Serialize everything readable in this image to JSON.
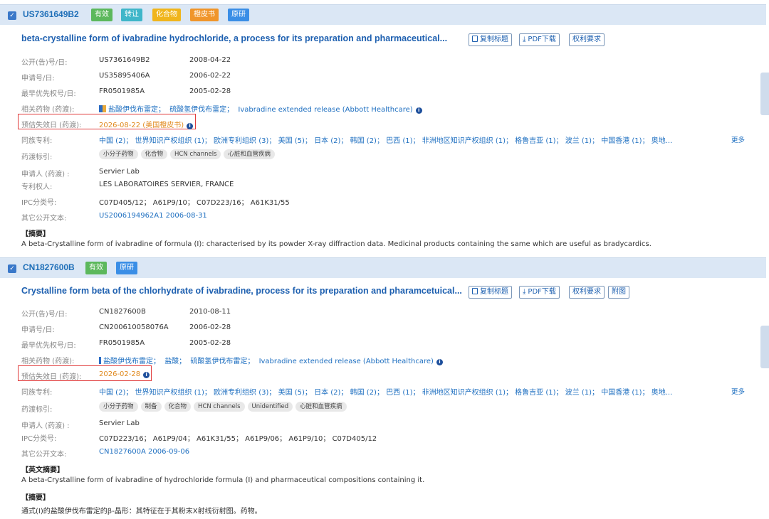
{
  "cards": [
    {
      "patent_number": "US7361649B2",
      "badges": [
        {
          "label": "有效",
          "color": "#5cb85c"
        },
        {
          "label": "转让",
          "color": "#3fb6c9"
        },
        {
          "label": "化合物",
          "color": "#f0b51c"
        },
        {
          "label": "橙皮书",
          "color": "#f0952a"
        },
        {
          "label": "原研",
          "color": "#3a8ee6"
        }
      ],
      "title": "beta-crystalline form of ivabradine hydrochloride, a process for its preparation and pharmaceutical...",
      "actions": [
        "复制标题",
        "PDF下载",
        "权利要求"
      ],
      "pub_label": "公开(告)号/日:",
      "pub_no": "US7361649B2",
      "pub_date": "2008-04-22",
      "app_label": "申请号/日:",
      "app_no": "US35895406A",
      "app_date": "2006-02-22",
      "prio_label": "最早优先权号/日:",
      "prio_no": "FR0501985A",
      "prio_date": "2005-02-28",
      "drugs_label": "相关药物 (药渡):",
      "drugs": [
        "盐酸伊伐布雷定；",
        "硫酸氢伊伐布雷定；",
        "Ivabradine extended release (Abbott Healthcare)"
      ],
      "expiry_label": "预估失效日 (药渡):",
      "expiry": "2026-08-22 (美国橙皮书)",
      "family_label": "同族专利:",
      "family": "中国 (2)； 世界知识产权组织 (1)； 欧洲专利组织 (3)； 美国 (5)； 日本 (2)； 韩国 (2)； 巴西 (1)； 非洲地区知识产权组织 (1)； 格鲁吉亚 (1)； 波兰 (1)； 中国香港 (1)； 奥地...",
      "more": "更多",
      "tags_label": "药渡标引:",
      "tags": [
        "小分子药物",
        "化合物",
        "HCN channels",
        "心脏和血管疾病"
      ],
      "applicant_label": "申请人 (药渡) :",
      "applicant": "Servier Lab",
      "owner_label": "专利权人:",
      "owner": "LES LABORATOIRES SERVIER, FRANCE",
      "ipc_label": "IPC分类号:",
      "ipc": "C07D405/12； A61P9/10； C07D223/16； A61K31/55",
      "other_label": "其它公开文本:",
      "other": "US2006194962A1 2006-08-31",
      "abstract_title": "【摘要】",
      "abstract": "A beta-Crystalline form of ivabradine of formula (I): characterised by its powder X-ray diffraction data. Medicinal products containing the same which are useful as bradycardics."
    },
    {
      "patent_number": "CN1827600B",
      "badges": [
        {
          "label": "有效",
          "color": "#5cb85c"
        },
        {
          "label": "原研",
          "color": "#3a8ee6"
        }
      ],
      "title": "Crystalline form beta of the chlorhydrate of ivabradine, process for its preparation and pharamcetuical...",
      "actions": [
        "复制标题",
        "PDF下载",
        "权利要求",
        "附图"
      ],
      "pub_label": "公开(告)号/日:",
      "pub_no": "CN1827600B",
      "pub_date": "2010-08-11",
      "app_label": "申请号/日:",
      "app_no": "CN200610058076A",
      "app_date": "2006-02-28",
      "prio_label": "最早优先权号/日:",
      "prio_no": "FR0501985A",
      "prio_date": "2005-02-28",
      "drugs_label": "相关药物 (药渡):",
      "drugs": [
        "盐酸伊伐布雷定；",
        "盐酸；",
        "硫酸氢伊伐布雷定；",
        "Ivabradine extended release (Abbott Healthcare)"
      ],
      "expiry_label": "预估失效日 (药渡):",
      "expiry": "2026-02-28",
      "family_label": "同族专利:",
      "family": "中国 (2)； 世界知识产权组织 (1)； 欧洲专利组织 (3)； 美国 (5)； 日本 (2)； 韩国 (2)； 巴西 (1)； 非洲地区知识产权组织 (1)； 格鲁吉亚 (1)； 波兰 (1)； 中国香港 (1)； 奥地...",
      "more": "更多",
      "tags_label": "药渡标引:",
      "tags": [
        "小分子药物",
        "制备",
        "化合物",
        "HCN channels",
        "Unidentified",
        "心脏和血管疾病"
      ],
      "applicant_label": "申请人 (药渡) :",
      "applicant": "Servier Lab",
      "ipc_label": "IPC分类号:",
      "ipc": "C07D223/16； A61P9/04； A61K31/55； A61P9/06； A61P9/10； C07D405/12",
      "other_label": "其它公开文本:",
      "other": "CN1827600A 2006-09-06",
      "en_abstract_title": "【英文摘要】",
      "en_abstract": "A beta-Crystalline form of ivabradine of hydrochloride formula (I) and pharmaceutical compositions containing it.",
      "abstract_title": "【摘要】",
      "abstract": "通式(I)的盐酸伊伐布雷定的β-晶形：其特征在于其粉末X射线衍射图。药物。"
    }
  ]
}
